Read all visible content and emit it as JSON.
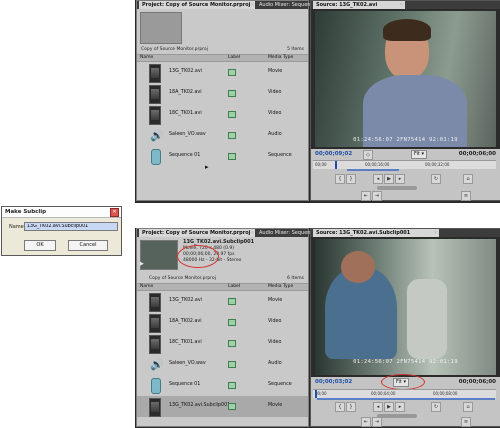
{
  "top": {
    "project": {
      "tab_title": "Project: Copy of Source Monitor.prproj",
      "tab_audio": "Audio Mixer: Sequen",
      "project_file": "Copy of Source Monitor.prproj",
      "item_count": "5 Items",
      "columns": {
        "name": "Name",
        "label": "Label",
        "media_type": "Media Type"
      },
      "items": [
        {
          "name": "13G_TK02.avi",
          "type": "Movie"
        },
        {
          "name": "18A_TK02.avi",
          "type": "Video"
        },
        {
          "name": "18C_TK01.avi",
          "type": "Video"
        },
        {
          "name": "Saleen_VO.wav",
          "type": "Audio"
        },
        {
          "name": "Sequence 01",
          "type": "Sequence"
        }
      ]
    },
    "source": {
      "tab_title": "Source: 13G_TK02.avi",
      "overlay_timecode": "01:24:56:07  2FN75414  92:01:19",
      "tc_in": "00;00;09;02",
      "tc_out": "00;00;06;00",
      "fit": "Fit",
      "ruler": [
        "00;00",
        "00;00;16;00",
        "00;00;32;00"
      ]
    }
  },
  "dialog": {
    "title": "Make Subclip",
    "name_label": "Name:",
    "name_value": "13G_TK02.avi.Subclip001",
    "ok_label": "OK",
    "cancel_label": "Cancel"
  },
  "bottom": {
    "project": {
      "tab_title": "Project: Copy of Source Monitor.prproj",
      "tab_audio": "Audio Mixer: Sequen",
      "preview": {
        "clip_name": "13G_TK02.avi.Subclip001",
        "line1": "Movie, 720 x 480 (0.9)",
        "line2": "00;00;06;00, 29.97 fps",
        "line3": "48000 Hz - 32-bit - Stereo"
      },
      "project_file": "Copy of Source Monitor.prproj",
      "item_count": "6 Items",
      "columns": {
        "name": "Name",
        "label": "Label",
        "media_type": "Media Type"
      },
      "items": [
        {
          "name": "13G_TK02.avi",
          "type": "Movie"
        },
        {
          "name": "18A_TK02.avi",
          "type": "Video"
        },
        {
          "name": "18C_TK01.avi",
          "type": "Video"
        },
        {
          "name": "Saleen_VO.wav",
          "type": "Audio"
        },
        {
          "name": "Sequence 01",
          "type": "Sequence"
        },
        {
          "name": "13G_TK02.avi.Subclip001",
          "type": "Movie"
        }
      ]
    },
    "source": {
      "tab_title": "Source: 13G_TK02.avi.Subclip001",
      "overlay_timecode": "01:24:56:07  2FN75414  92:01:19",
      "tc_in": "00;00;03;02",
      "tc_out": "00;00;06;00",
      "fit": "Fit",
      "ruler": [
        "00;00",
        "00;00;04;00",
        "00;00;08;00"
      ]
    }
  },
  "colors": {
    "annotation_circle": "#d8302a",
    "label_green": "#9fd0a8",
    "timecode_blue": "#1f4fa8"
  }
}
